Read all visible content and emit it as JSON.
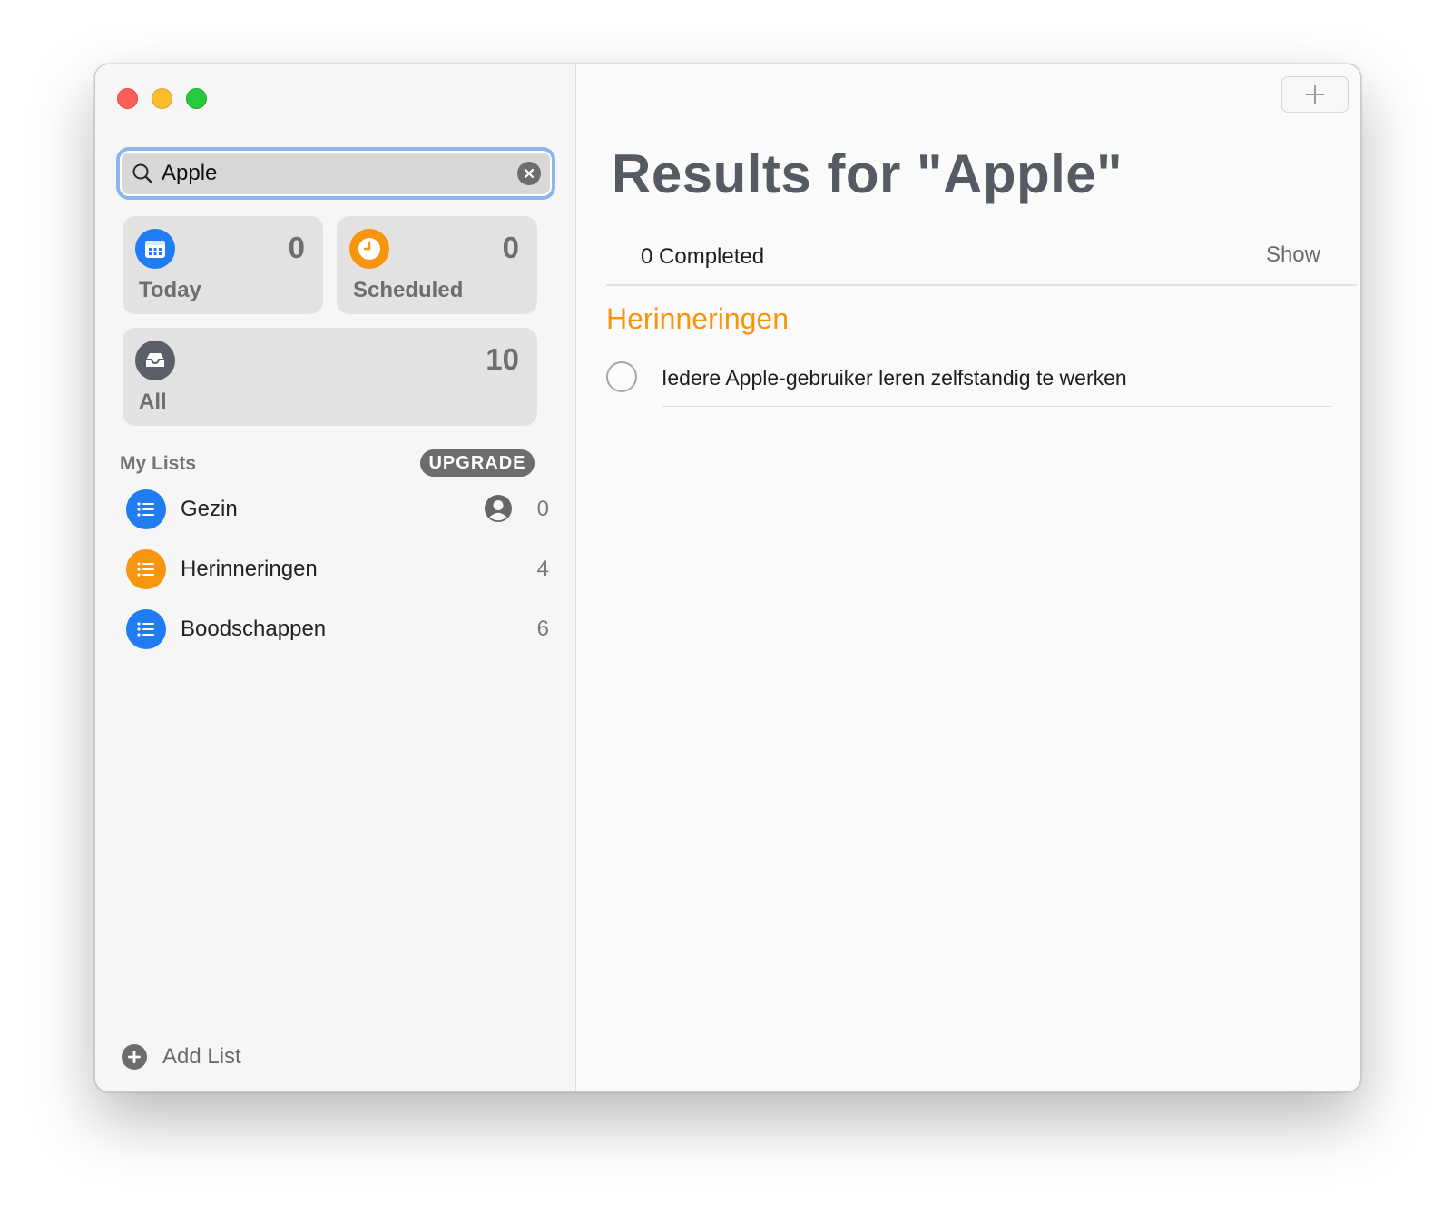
{
  "window": {
    "controls": [
      "close",
      "minimize",
      "zoom"
    ]
  },
  "sidebar": {
    "search": {
      "value": "Apple",
      "placeholder": "Search",
      "icon": "search-icon",
      "clear_icon": "clear-icon"
    },
    "smart_lists": [
      {
        "label": "Today",
        "count": "0",
        "icon": "calendar-icon",
        "color": "#1f7cf2"
      },
      {
        "label": "Scheduled",
        "count": "0",
        "icon": "clock-icon",
        "color": "#f7960d"
      },
      {
        "label": "All",
        "count": "10",
        "icon": "tray-icon",
        "color": "#5b6068"
      }
    ],
    "my_lists_header": "My Lists",
    "upgrade_label": "UPGRADE",
    "lists": [
      {
        "label": "Gezin",
        "count": "0",
        "color": "#1f7cf2",
        "shared": true,
        "icon": "list-icon"
      },
      {
        "label": "Herinneringen",
        "count": "4",
        "color": "#f7960d",
        "shared": false,
        "icon": "list-icon"
      },
      {
        "label": "Boodschappen",
        "count": "6",
        "color": "#1f7cf2",
        "shared": false,
        "icon": "list-icon"
      }
    ],
    "add_list_label": "Add List"
  },
  "main": {
    "title": "Results for \"Apple\"",
    "completed_label": "0 Completed",
    "show_label": "Show",
    "groups": [
      {
        "title": "Herinneringen",
        "color": "#f7960d",
        "items": [
          {
            "title": "Iedere Apple-gebruiker leren zelfstandig te werken",
            "completed": false
          }
        ]
      }
    ]
  }
}
